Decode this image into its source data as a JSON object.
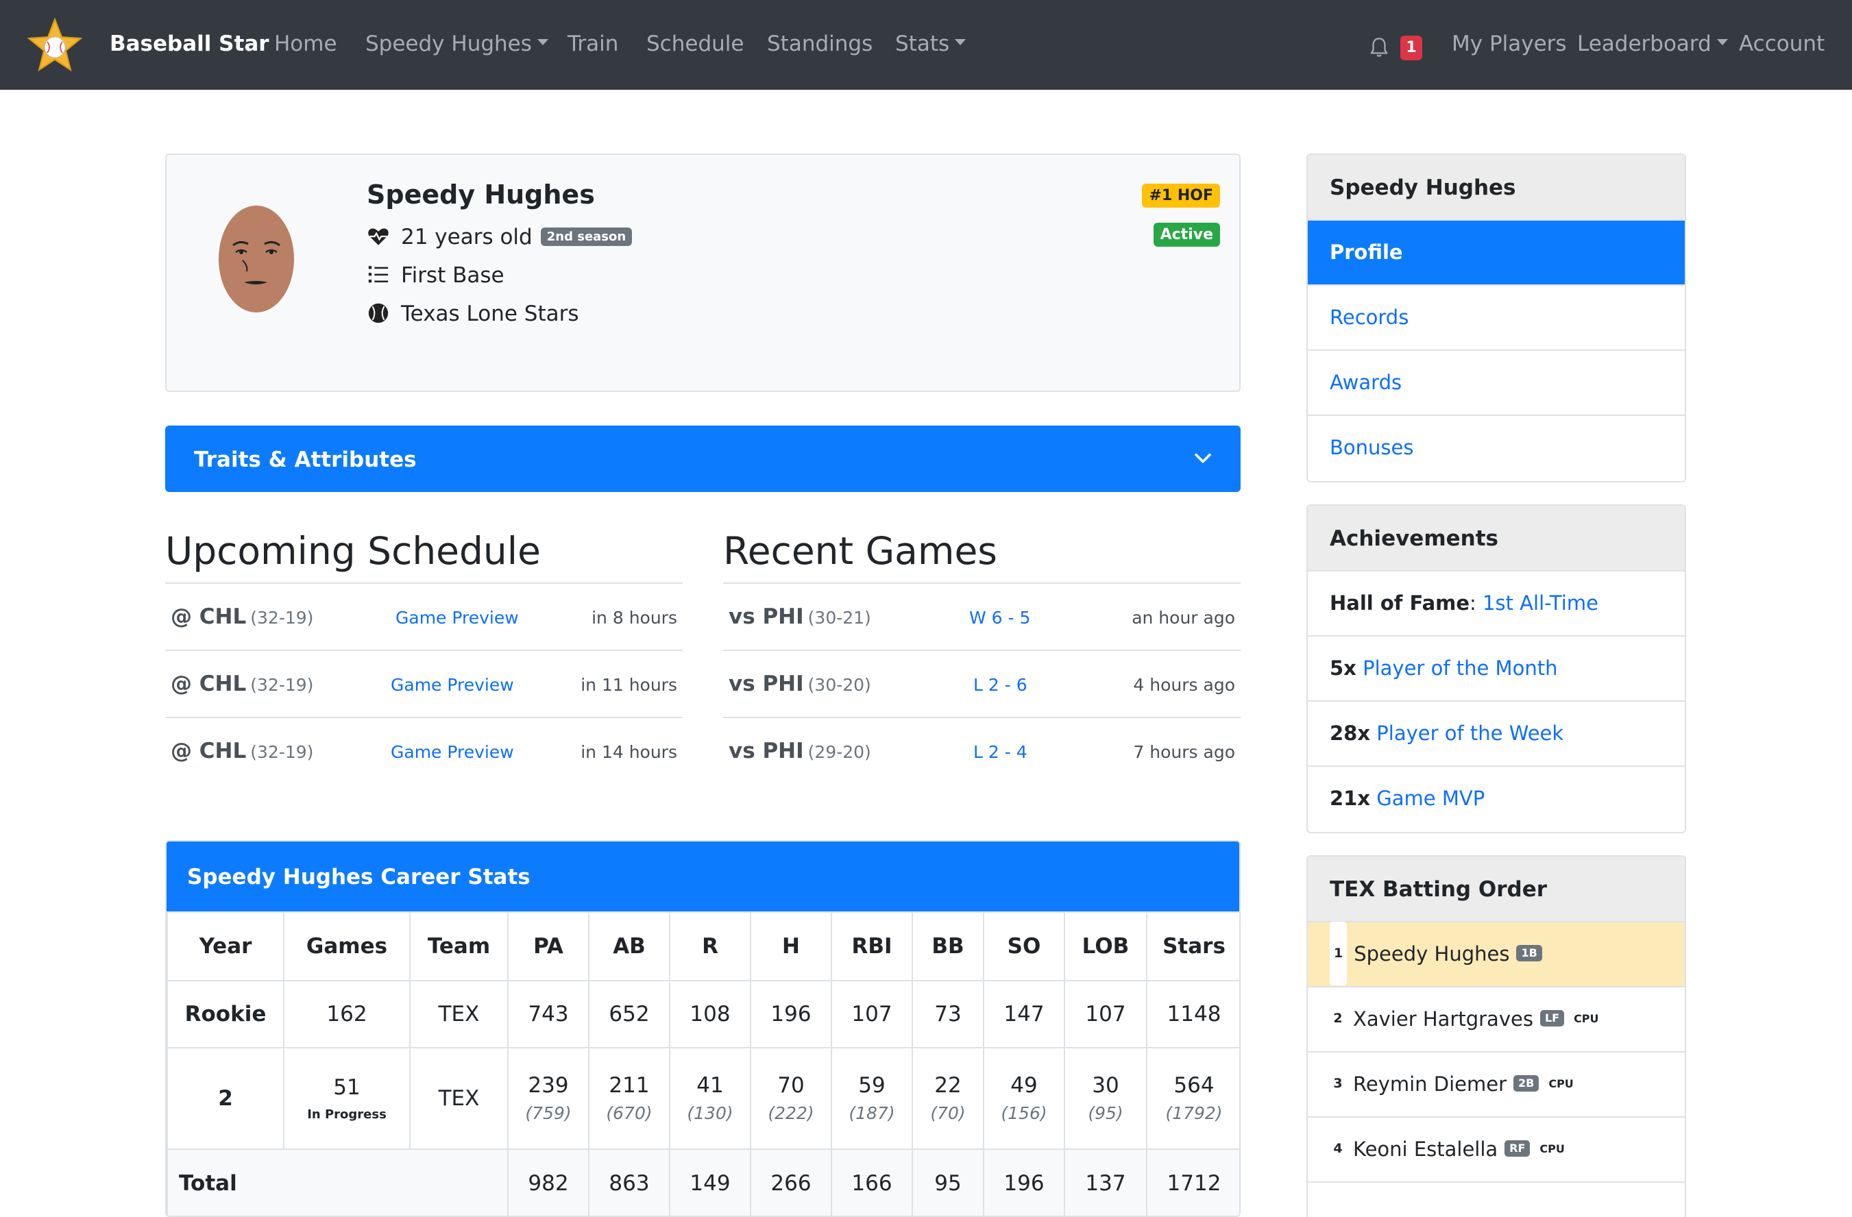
{
  "nav": {
    "brand": "Baseball Star",
    "links": [
      "Home",
      "Speedy Hughes",
      "Train",
      "Schedule",
      "Standings",
      "Stats"
    ],
    "notification_count": "1",
    "right_links": [
      "My Players",
      "Leaderboard",
      "Account"
    ]
  },
  "profile": {
    "name": "Speedy Hughes",
    "age": "21 years old",
    "season_badge": "2nd season",
    "position": "First Base",
    "team": "Texas Lone Stars",
    "hof_badge": "#1 HOF",
    "status_badge": "Active"
  },
  "traits": {
    "title": "Traits & Attributes"
  },
  "upcoming": {
    "title": "Upcoming Schedule",
    "games": [
      {
        "opponent": "@ CHL",
        "record": "(32-19)",
        "link": "Game Preview",
        "when": "in 8 hours"
      },
      {
        "opponent": "@ CHL",
        "record": "(32-19)",
        "link": "Game Preview",
        "when": "in 11 hours"
      },
      {
        "opponent": "@ CHL",
        "record": "(32-19)",
        "link": "Game Preview",
        "when": "in 14 hours"
      }
    ]
  },
  "recent": {
    "title": "Recent Games",
    "games": [
      {
        "opponent": "vs PHI",
        "record": "(30-21)",
        "result": "W 6 - 5",
        "when": "an hour ago"
      },
      {
        "opponent": "vs PHI",
        "record": "(30-20)",
        "result": "L 2 - 6",
        "when": "4 hours ago"
      },
      {
        "opponent": "vs PHI",
        "record": "(29-20)",
        "result": "L 2 - 4",
        "when": "7 hours ago"
      }
    ]
  },
  "career": {
    "title": "Speedy Hughes Career Stats",
    "headers": [
      "Year",
      "Games",
      "Team",
      "PA",
      "AB",
      "R",
      "H",
      "RBI",
      "BB",
      "SO",
      "LOB",
      "Stars"
    ],
    "rookie": [
      "Rookie",
      "162",
      "TEX",
      "743",
      "652",
      "108",
      "196",
      "107",
      "73",
      "147",
      "107",
      "1148"
    ],
    "season2": [
      "2",
      "51",
      "TEX",
      "239",
      "211",
      "41",
      "70",
      "59",
      "22",
      "49",
      "30",
      "564"
    ],
    "season2_projected": [
      "(759)",
      "(670)",
      "(130)",
      "(222)",
      "(187)",
      "(70)",
      "(156)",
      "(95)",
      "(1792)"
    ],
    "season2_status": "In Progress",
    "total_label": "Total",
    "total": [
      "982",
      "863",
      "149",
      "266",
      "166",
      "95",
      "196",
      "137",
      "1712"
    ]
  },
  "sidebar": {
    "player_menu": {
      "title": "Speedy Hughes",
      "items": [
        "Profile",
        "Records",
        "Awards",
        "Bonuses"
      ]
    },
    "achievements": {
      "title": "Achievements",
      "items": [
        {
          "label": "Hall of Fame",
          "sep": ": ",
          "link": "1st All-Time"
        },
        {
          "label": "5x",
          "sep": " ",
          "link": "Player of the Month"
        },
        {
          "label": "28x",
          "sep": " ",
          "link": "Player of the Week"
        },
        {
          "label": "21x",
          "sep": " ",
          "link": "Game MVP"
        }
      ]
    },
    "batting_order": {
      "title": "TEX Batting Order",
      "players": [
        {
          "num": "1",
          "name": "Speedy Hughes",
          "pos": "1B",
          "cpu": ""
        },
        {
          "num": "2",
          "name": "Xavier Hartgraves",
          "pos": "LF",
          "cpu": "CPU"
        },
        {
          "num": "3",
          "name": "Reymin Diemer",
          "pos": "2B",
          "cpu": "CPU"
        },
        {
          "num": "4",
          "name": "Keoni Estalella",
          "pos": "RF",
          "cpu": "CPU"
        }
      ]
    }
  },
  "colors": {
    "navbar": "#343a40",
    "primary": "#0d7bfd",
    "hof_badge": "#ffc107",
    "active_badge": "#28a745",
    "notification": "#dc3545",
    "highlight_row": "#fcebb8"
  }
}
